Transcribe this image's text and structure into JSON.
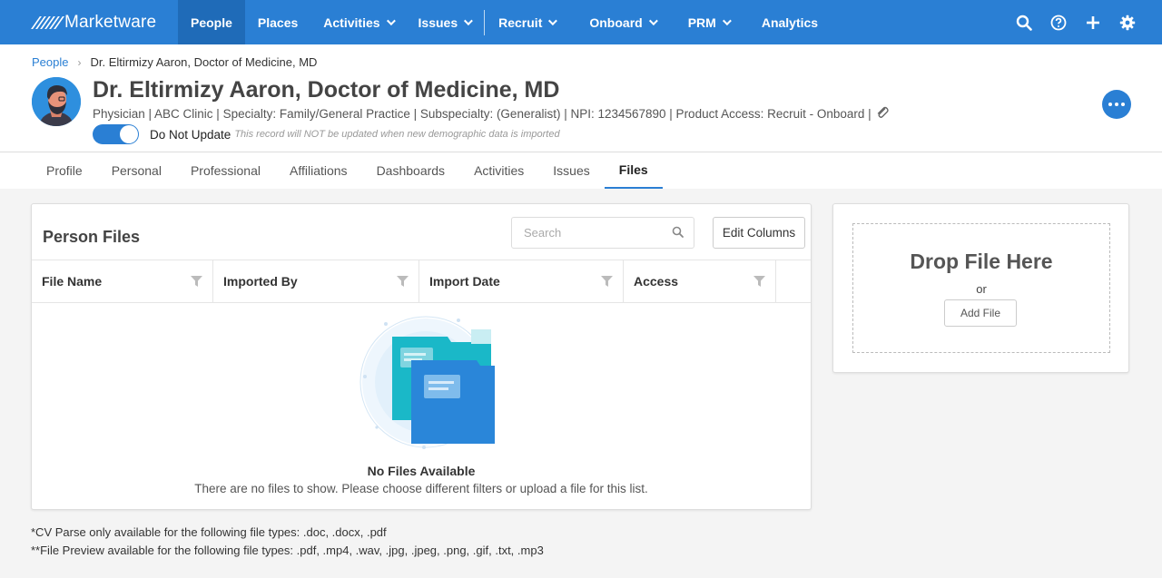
{
  "nav": {
    "brand": "Marketware",
    "items": [
      {
        "label": "People",
        "active": true,
        "dropdown": false
      },
      {
        "label": "Places",
        "active": false,
        "dropdown": false
      },
      {
        "label": "Activities",
        "active": false,
        "dropdown": true
      },
      {
        "label": "Issues",
        "active": false,
        "dropdown": true
      },
      {
        "label": "Recruit",
        "active": false,
        "dropdown": true
      },
      {
        "label": "Onboard",
        "active": false,
        "dropdown": true
      },
      {
        "label": "PRM",
        "active": false,
        "dropdown": true
      },
      {
        "label": "Analytics",
        "active": false,
        "dropdown": false
      }
    ],
    "icons": [
      "search-icon",
      "help-icon",
      "plus-icon",
      "gear-icon"
    ]
  },
  "breadcrumb": {
    "root": "People",
    "current": "Dr. Eltirmizy Aaron, Doctor of Medicine, MD"
  },
  "person": {
    "name": "Dr. Eltirmizy Aaron, Doctor of Medicine, MD",
    "details": "Physician | ABC Clinic | Specialty: Family/General Practice | Subspecialty: (Generalist) | NPI: 1234567890 | Product Access: Recruit - Onboard |",
    "do_not_update_label": "Do Not Update",
    "do_not_update_note": "This record will NOT be updated when new demographic data is imported",
    "do_not_update_on": true
  },
  "tabs": [
    {
      "label": "Profile",
      "active": false
    },
    {
      "label": "Personal",
      "active": false
    },
    {
      "label": "Professional",
      "active": false
    },
    {
      "label": "Affiliations",
      "active": false
    },
    {
      "label": "Dashboards",
      "active": false
    },
    {
      "label": "Activities",
      "active": false
    },
    {
      "label": "Issues",
      "active": false
    },
    {
      "label": "Files",
      "active": true
    }
  ],
  "files": {
    "title": "Person Files",
    "search_placeholder": "Search",
    "edit_columns_label": "Edit Columns",
    "columns": [
      "File Name",
      "Imported By",
      "Import Date",
      "Access"
    ],
    "empty_title": "No Files Available",
    "empty_text": "There are no files to show. Please choose different filters or upload a file for this list."
  },
  "drop": {
    "title": "Drop File Here",
    "or": "or",
    "add_file_label": "Add File"
  },
  "notes": [
    "*CV Parse only available for the following file types: .doc, .docx, .pdf",
    "**File Preview available for the following file types: .pdf, .mp4, .wav, .jpg, .jpeg, .png, .gif, .txt, .mp3"
  ],
  "colors": {
    "primary": "#2a7fd4",
    "nav_active": "#1f6bb8",
    "folder_teal": "#1ab8c8",
    "folder_blue": "#2a86d9"
  }
}
